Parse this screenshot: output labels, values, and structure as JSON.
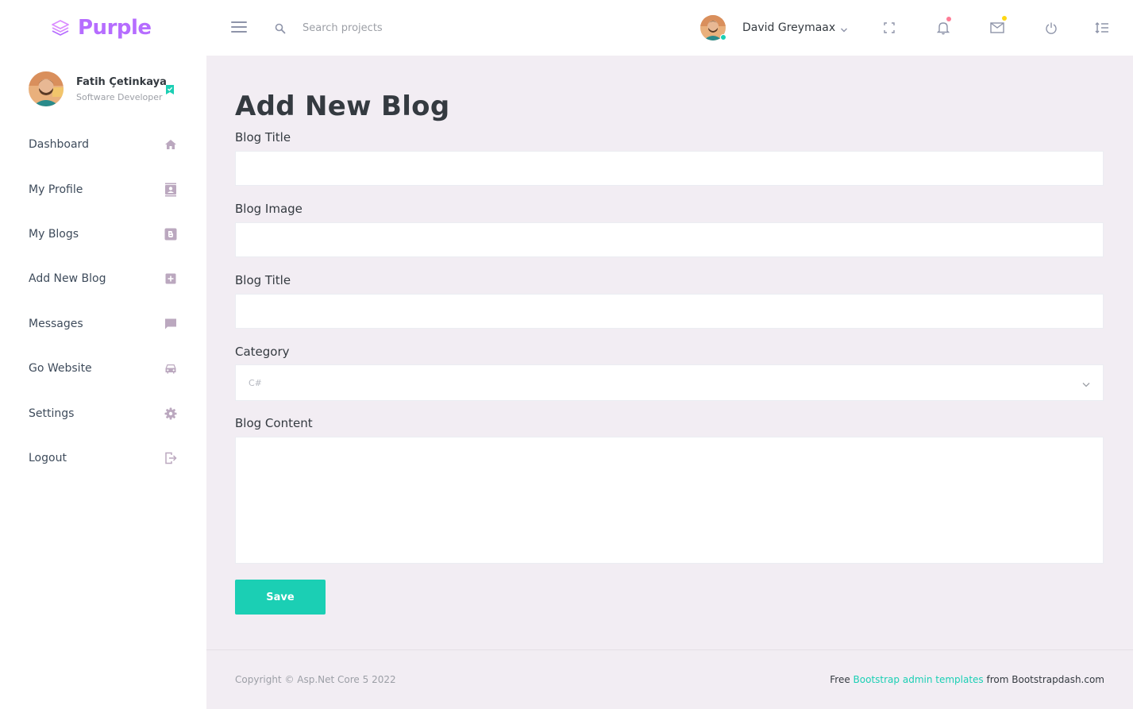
{
  "brand": {
    "name": "Purple"
  },
  "navbar": {
    "search_placeholder": "Search projects",
    "username": "David Greymaax"
  },
  "sidebar": {
    "profile": {
      "name": "Fatih Çetinkaya",
      "role": "Software Developer"
    },
    "items": [
      {
        "label": "Dashboard",
        "icon": "home-icon"
      },
      {
        "label": "My Profile",
        "icon": "contacts-icon"
      },
      {
        "label": "My Blogs",
        "icon": "blogger-icon"
      },
      {
        "label": "Add New Blog",
        "icon": "plus-box-icon"
      },
      {
        "label": "Messages",
        "icon": "message-icon"
      },
      {
        "label": "Go Website",
        "icon": "car-icon"
      },
      {
        "label": "Settings",
        "icon": "gear-icon"
      },
      {
        "label": "Logout",
        "icon": "logout-icon"
      }
    ]
  },
  "form": {
    "page_title": "Add New Blog",
    "fields": {
      "blog_title_label": "Blog Title",
      "blog_image_label": "Blog Image",
      "blog_title2_label": "Blog Title",
      "category_label": "Category",
      "category_value": "C#",
      "content_label": "Blog Content"
    },
    "save_label": "Save"
  },
  "footer": {
    "copyright": "Copyright © Asp.Net Core 5 2022",
    "credit_prefix": "Free ",
    "credit_link": "Bootstrap admin templates",
    "credit_suffix": " from Bootstrapdash.com"
  },
  "colors": {
    "accent": "#b66dff",
    "success": "#1bcfb4",
    "danger_dot": "#fe7c96",
    "warning_dot": "#fed713",
    "page_bg": "#f2edf3",
    "sidebar_icon": "#bba8bff5"
  }
}
